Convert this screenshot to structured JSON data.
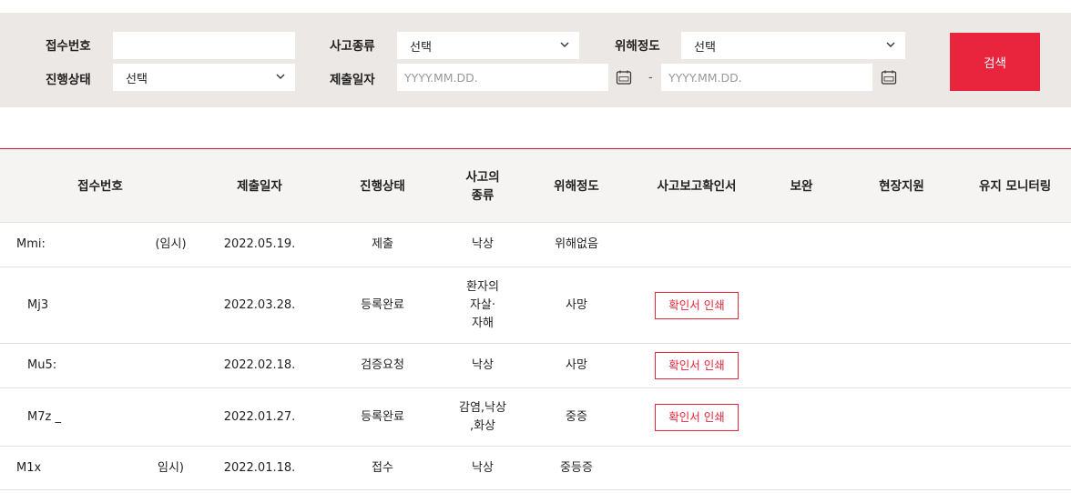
{
  "search": {
    "receipt_no_label": "접수번호",
    "receipt_no_value": "",
    "accident_type_label": "사고종류",
    "accident_type_value": "선택",
    "severity_label": "위해정도",
    "severity_value": "선택",
    "status_label": "진행상태",
    "status_value": "선택",
    "submit_date_label": "제출일자",
    "date_from_placeholder": "YYYY.MM.DD.",
    "date_to_placeholder": "YYYY.MM.DD.",
    "date_separator": "-",
    "search_button": "검색"
  },
  "table": {
    "headers": {
      "receipt_no": "접수번호",
      "submit_date": "제출일자",
      "status": "진행상태",
      "accident_type": "사고의\n종류",
      "severity": "위해정도",
      "confirmation": "사고보고확인서",
      "supplement": "보완",
      "field_support": "현장지원",
      "monitoring": "유지 모니터링"
    },
    "rows": [
      {
        "receipt_no": "Mmi:",
        "temp": "(임시)",
        "submit_date": "2022.05.19.",
        "status": "제출",
        "accident_type": "낙상",
        "severity": "위해없음",
        "print_label": ""
      },
      {
        "receipt_no": "Mj3",
        "temp": "",
        "submit_date": "2022.03.28.",
        "status": "등록완료",
        "accident_type": "환자의\n자살·\n자해",
        "severity": "사망",
        "print_label": "확인서 인쇄"
      },
      {
        "receipt_no": "Mu5:",
        "temp": "",
        "submit_date": "2022.02.18.",
        "status": "검증요청",
        "accident_type": "낙상",
        "severity": "사망",
        "print_label": "확인서 인쇄"
      },
      {
        "receipt_no": "M7z _",
        "temp": "",
        "submit_date": "2022.01.27.",
        "status": "등록완료",
        "accident_type": "감염,낙상\n,화상",
        "severity": "중증",
        "print_label": "확인서 인쇄"
      },
      {
        "receipt_no": "M1x",
        "temp": "임시)",
        "submit_date": "2022.01.18.",
        "status": "접수",
        "accident_type": "낙상",
        "severity": "중등증",
        "print_label": ""
      }
    ]
  },
  "colors": {
    "accent": "#e8253c",
    "panel_bg": "#ece8e6",
    "header_bg": "#f6f4f3"
  },
  "icons": {
    "select_arrow": "chevron-down-icon",
    "calendar": "calendar-icon"
  }
}
